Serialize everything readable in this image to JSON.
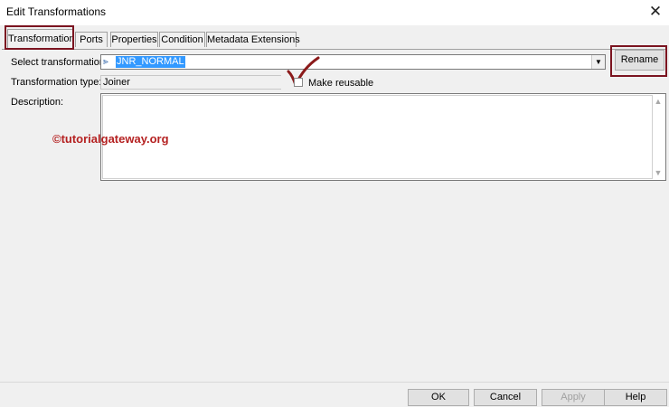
{
  "window": {
    "title": "Edit Transformations",
    "close_glyph": "✕"
  },
  "tabs": [
    {
      "label": "Transformation",
      "active": true
    },
    {
      "label": "Ports"
    },
    {
      "label": "Properties"
    },
    {
      "label": "Condition"
    },
    {
      "label": "Metadata Extensions"
    }
  ],
  "form": {
    "select_label": "Select transformation:",
    "select_icon": "joiner-icon",
    "select_value": "JNR_NORMAL",
    "type_label": "Transformation type:",
    "type_value": "Joiner",
    "reusable_label": "Make reusable",
    "description_label": "Description:",
    "description_value": ""
  },
  "rename_label": "Rename",
  "watermark": "©tutorialgateway.org",
  "footer": {
    "ok": "OK",
    "cancel": "Cancel",
    "apply": "Apply",
    "help": "Help"
  },
  "colors": {
    "highlight_box": "#7b1420",
    "selection": "#3399ff",
    "watermark": "#b52222"
  }
}
